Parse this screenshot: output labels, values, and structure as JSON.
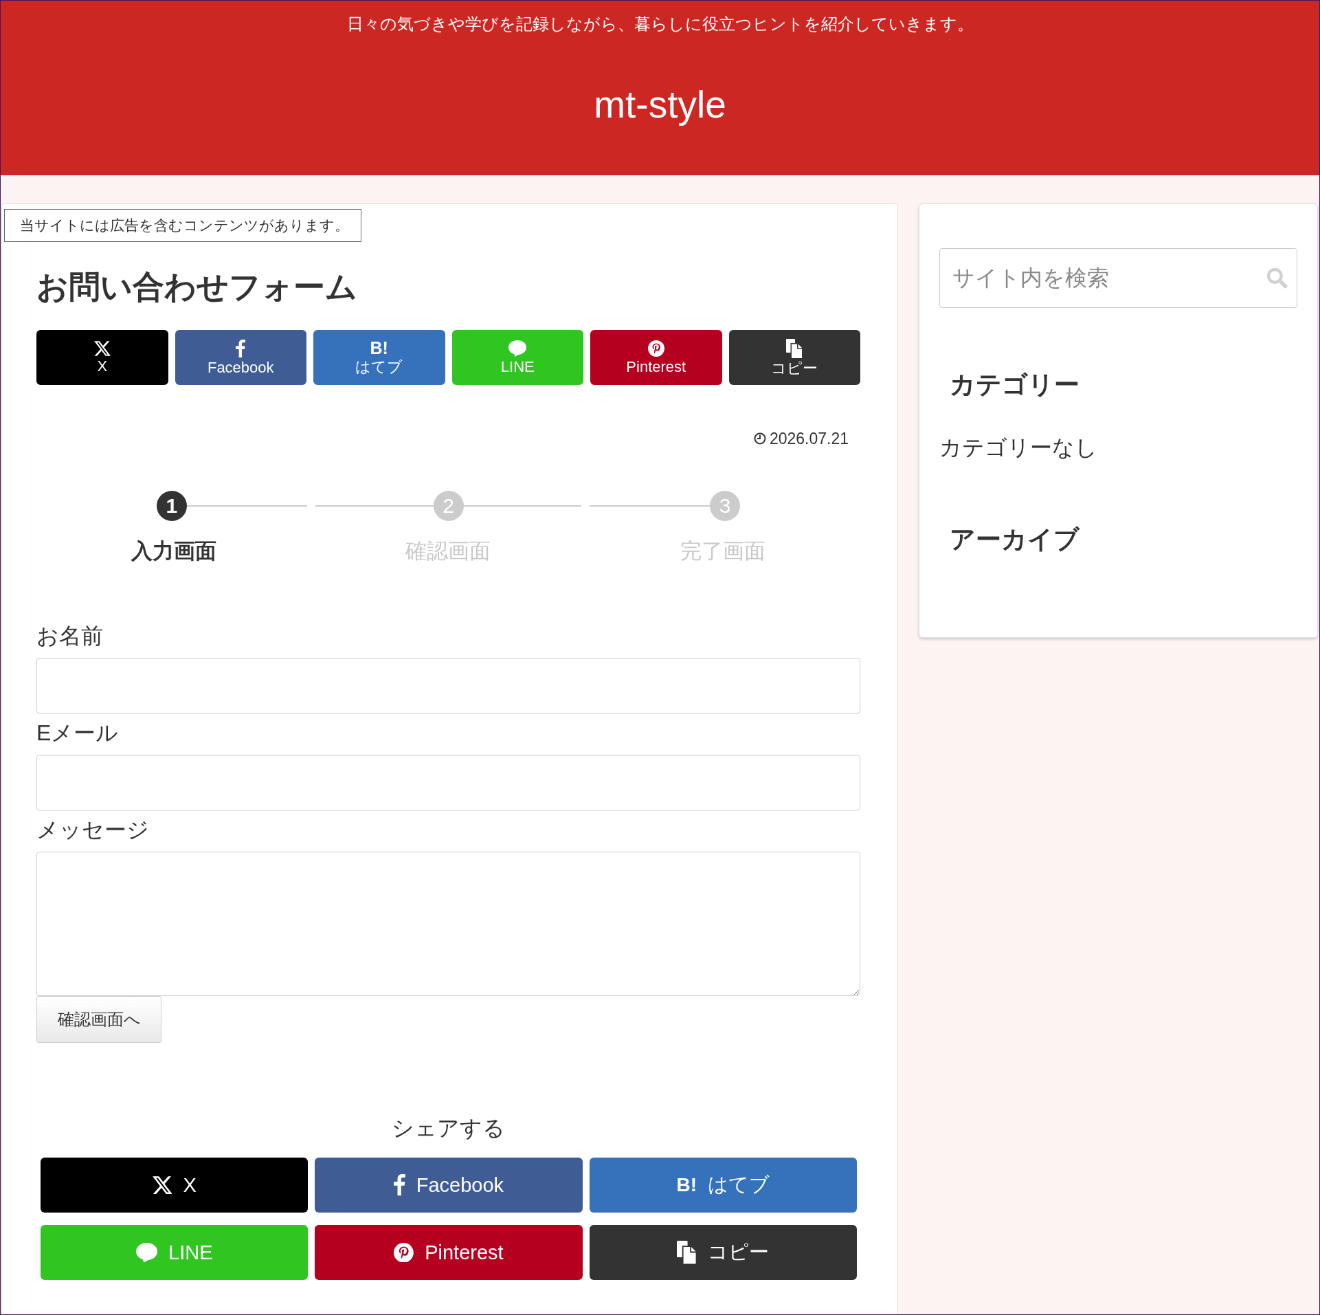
{
  "header": {
    "tagline": "日々の気づきや学びを記録しながら、暮らしに役立つヒントを紹介していきます。",
    "site_title": "mt-style"
  },
  "notice": "当サイトには広告を含むコンテンツがあります。",
  "article": {
    "title": "お問い合わせフォーム",
    "share_top": [
      {
        "kind": "x",
        "label": "X"
      },
      {
        "kind": "facebook",
        "label": "Facebook"
      },
      {
        "kind": "hatena",
        "icon_text": "B!",
        "label": "はてブ"
      },
      {
        "kind": "line",
        "label": "LINE"
      },
      {
        "kind": "pinterest",
        "label": "Pinterest"
      },
      {
        "kind": "copy",
        "label": "コピー"
      }
    ],
    "date": "2026.07.21",
    "steps": [
      {
        "number": "1",
        "label": "入力画面",
        "active": true
      },
      {
        "number": "2",
        "label": "確認画面",
        "active": false
      },
      {
        "number": "3",
        "label": "完了画面",
        "active": false
      }
    ],
    "form": {
      "fields": [
        {
          "kind": "text",
          "label": "お名前"
        },
        {
          "kind": "text",
          "label": "Eメール"
        },
        {
          "kind": "textarea",
          "label": "メッセージ"
        }
      ],
      "submit": "確認画面へ"
    },
    "share_bottom": {
      "heading": "シェアする",
      "buttons": [
        {
          "kind": "x",
          "label": "X"
        },
        {
          "kind": "facebook",
          "label": "Facebook"
        },
        {
          "kind": "hatena",
          "icon_text": "B!",
          "label": "はてブ"
        },
        {
          "kind": "line",
          "label": "LINE"
        },
        {
          "kind": "pinterest",
          "label": "Pinterest"
        },
        {
          "kind": "copy",
          "label": "コピー"
        }
      ]
    }
  },
  "sidebar": {
    "search": {
      "placeholder": "サイト内を検索"
    },
    "widgets": [
      {
        "heading": "カテゴリー",
        "items": [
          "カテゴリーなし"
        ]
      },
      {
        "heading": "アーカイブ"
      }
    ]
  }
}
